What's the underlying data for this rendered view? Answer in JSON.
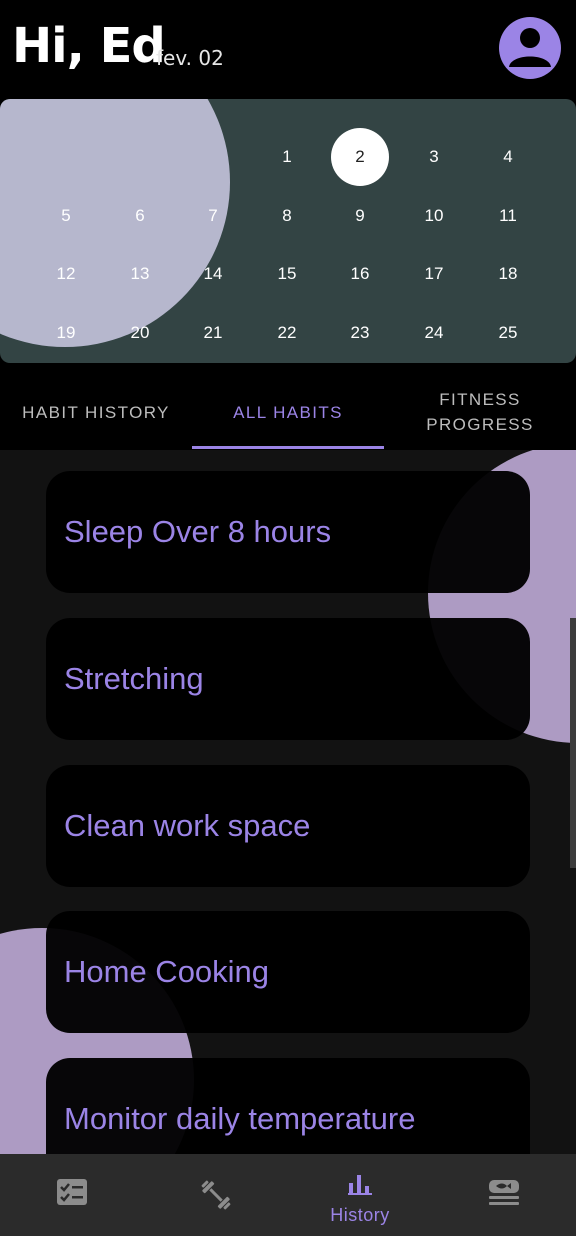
{
  "header": {
    "greeting": "Hi, Ed",
    "date": "fev. 02"
  },
  "calendar": {
    "rows": [
      [
        "",
        "",
        "",
        "1",
        "2",
        "3",
        "4"
      ],
      [
        "5",
        "6",
        "7",
        "8",
        "9",
        "10",
        "11"
      ],
      [
        "12",
        "13",
        "14",
        "15",
        "16",
        "17",
        "18"
      ],
      [
        "19",
        "20",
        "21",
        "22",
        "23",
        "24",
        "25"
      ]
    ],
    "selected_day": "2"
  },
  "tabs": [
    {
      "label": "HABIT HISTORY",
      "active": false
    },
    {
      "label": "ALL HABITS",
      "active": true
    },
    {
      "label": "FITNESS PROGRESS",
      "active": false
    }
  ],
  "habits": [
    "Sleep Over 8 hours",
    "Stretching",
    "Clean work space",
    "Home Cooking",
    "Monitor daily temperature"
  ],
  "bottom_nav": [
    {
      "icon": "checklist-icon",
      "label": "",
      "active": false
    },
    {
      "icon": "dumbbell-icon",
      "label": "",
      "active": false
    },
    {
      "icon": "bar-chart-icon",
      "label": "History",
      "active": true
    },
    {
      "icon": "meal-icon",
      "label": "",
      "active": false
    }
  ],
  "colors": {
    "accent": "#9b84e6",
    "calendar_bg": "#334444",
    "blob": "#ad9bc3",
    "card_bg": "#000000",
    "nav_bg": "#2b2b2b"
  }
}
